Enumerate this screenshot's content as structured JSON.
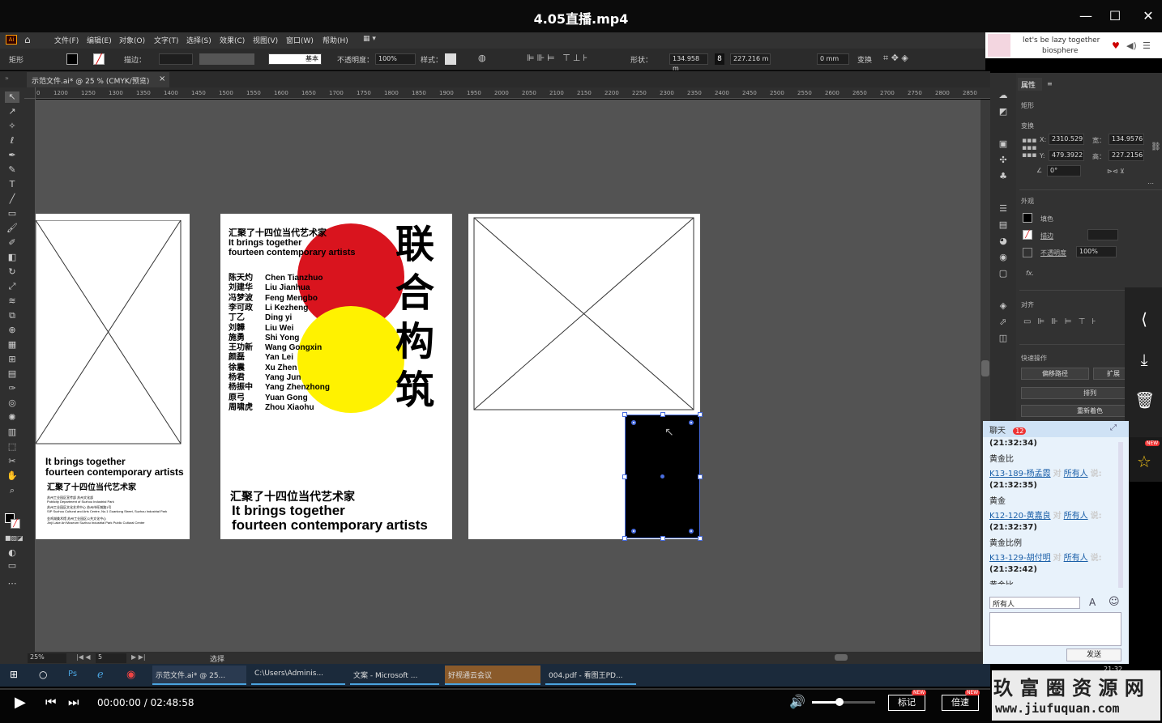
{
  "window": {
    "title": "4.05直播.mp4",
    "controls": [
      "—",
      "☐",
      "✕"
    ]
  },
  "menu": {
    "items": [
      "文件(F)",
      "编辑(E)",
      "对象(O)",
      "文字(T)",
      "选择(S)",
      "效果(C)",
      "视图(V)",
      "窗口(W)",
      "帮助(H)"
    ]
  },
  "control": {
    "object_type": "矩形",
    "stroke_label": "描边：",
    "stroke_style": "基本",
    "opacity_label": "不透明度：",
    "opacity_value": "100%",
    "style_label": "样式：",
    "shape_label": "形状：",
    "width_value": "134.958 m",
    "height_value": "227.216 m",
    "corner_value": "0 mm",
    "transform_label": "变换"
  },
  "doc_tab": {
    "label": "示范文件.ai* @ 25 % (CMYK/预览)",
    "close": "×"
  },
  "ruler": {
    "ticks": [
      "0",
      "1200",
      "1250",
      "1300",
      "1350",
      "1400",
      "1450",
      "1500",
      "1550",
      "1600",
      "1650",
      "1700",
      "1750",
      "1800",
      "1850",
      "1900",
      "1950",
      "2000",
      "2050",
      "2100",
      "2150",
      "2200",
      "2250",
      "2300",
      "2350",
      "2400",
      "2450",
      "2500",
      "2550",
      "2600",
      "2650",
      "2700",
      "2750",
      "2800",
      "2850"
    ]
  },
  "artboard1": {
    "line1": "It brings together",
    "line2": "fourteen contemporary artists",
    "title_cn": "汇聚了十四位当代艺术家",
    "small1": "苏州工业园区宣传部 苏州文化部",
    "small2": "Publicity Department of Suzhou Industrial Park",
    "small3": "苏州工业园区文化艺术中心 苏州市旺墩路1号",
    "small4": "SIP Suzhou Cultural and Arts Centre, No.1 Guanlong Street, Suzhou Industrial Park",
    "small5": "金鸡湖美术馆 苏州工业园区公共文化中心",
    "small6": "Jinji Lake Art Museum Suzhou Industrial Park Public Cultural Center"
  },
  "poster": {
    "header_cn": "汇聚了十四位当代艺术家",
    "header_en1": "It brings together",
    "header_en2": "fourteen contemporary artists",
    "vertical_title": [
      "联",
      "合",
      "构",
      "筑"
    ],
    "artists_cn": [
      "陈天灼",
      "刘建华",
      "冯梦波",
      "李可政",
      "丁乙",
      "刘韡",
      "施勇",
      "王功新",
      "颜磊",
      "徐震",
      "杨君",
      "杨振中",
      "原弓",
      "周啸虎"
    ],
    "artists_en": [
      "Chen Tianzhuo",
      "Liu Jianhua",
      "Feng Mengbo",
      "Li Kezheng",
      "Ding yi",
      "Liu Wei",
      "Shi Yong",
      "Wang Gongxin",
      "Yan Lei",
      "Xu Zhen",
      "Yang Jun",
      "Yang Zhenzhong",
      "Yuan Gong",
      "Zhou Xiaohu"
    ],
    "footer_cn": "汇聚了十四位当代艺术家",
    "footer_en1": "It brings together",
    "footer_en2": "fourteen contemporary artists",
    "colors": {
      "red": "#d9141e",
      "yellow": "#fff200"
    }
  },
  "status": {
    "zoom": "25%",
    "page": "5",
    "tool": "选择"
  },
  "panel": {
    "tab": "属性",
    "object": "矩形",
    "transform_title": "变换",
    "x_label": "X:",
    "x_value": "2310.529",
    "y_label": "Y:",
    "y_value": "479.3922",
    "w_label": "宽：",
    "w_value": "134.9576",
    "h_label": "高：",
    "h_value": "227.2156",
    "angle_value": "0°",
    "appearance_title": "外观",
    "fill_label": "填色",
    "stroke_label": "描边",
    "opacity_label": "不透明度",
    "opacity_value": "100%",
    "fx": "fx.",
    "align_title": "对齐",
    "quick_title": "快速操作",
    "offset_button": "偏移路径",
    "expand_button": "扩展",
    "arrange_button": "排列",
    "recolor_button": "重新着色"
  },
  "ad": {
    "line1": "let's be lazy together",
    "line2": "biosphere"
  },
  "chat": {
    "title": "聊天",
    "badge": "12",
    "messages": [
      {
        "time": "(21:32:34)",
        "text": "黄金比"
      },
      {
        "user": "K13-189-杨孟霞",
        "to": "对",
        "target": "所有人",
        "said": "说:",
        "time": "(21:32:35)",
        "text": "黄金"
      },
      {
        "user": "K12-120-黄嘉良",
        "to": "对",
        "target": "所有人",
        "said": "说:",
        "time": "(21:32:37)",
        "text": "黄金比例"
      },
      {
        "user": "K13-129-胡付明",
        "to": "对",
        "target": "所有人",
        "said": "说:",
        "time": "(21:32:42)",
        "text": "黄金比"
      }
    ],
    "recipient": "所有人",
    "send": "发送",
    "clock": "21:32"
  },
  "taskbar": {
    "items": [
      "示范文件.ai* @ 25...",
      "C:\\Users\\Adminis...",
      "文案 - Microsoft ...",
      "好视通云会议",
      "004.pdf - 看图王PD..."
    ]
  },
  "player": {
    "time": "00:00:00 / 02:48:58",
    "mark": "标记",
    "speed": "倍速",
    "new": "NEW",
    "watermark1": "玖 富 圈 资 源 网",
    "watermark2": "www.jiufuquan.com"
  }
}
